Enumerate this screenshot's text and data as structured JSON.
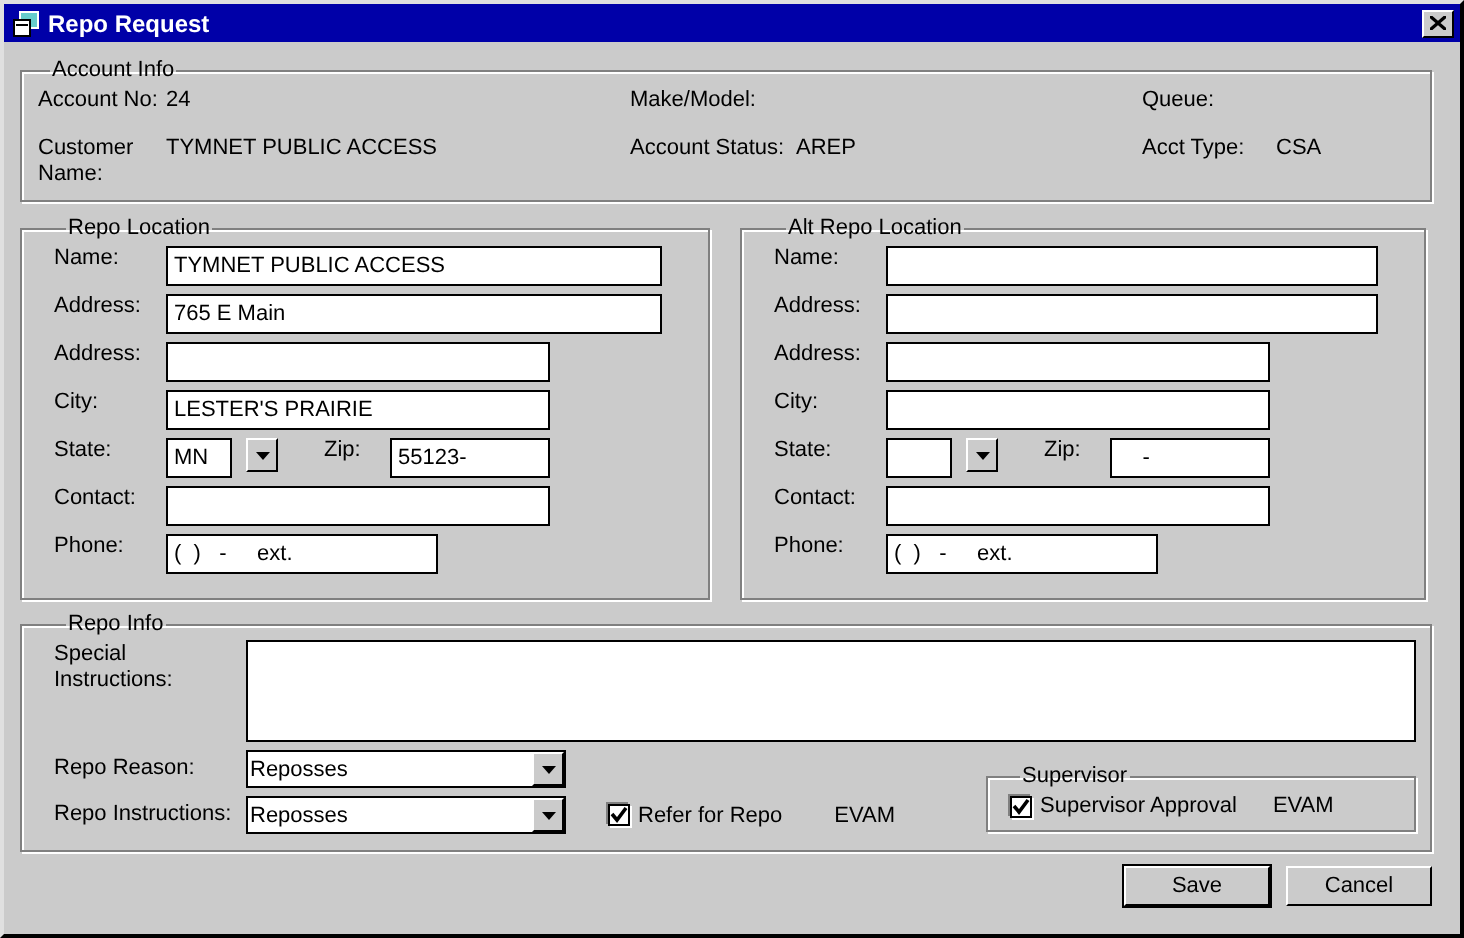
{
  "window": {
    "title": "Repo Request"
  },
  "account_info": {
    "title": "Account Info",
    "fields": [
      {
        "label": "Account No:",
        "value": "24"
      },
      {
        "label": "Make/Model:"
      },
      {
        "label": "Queue:"
      },
      {
        "label": "Customer Name:",
        "value": "TYMNET PUBLIC ACCESS"
      },
      {
        "label": "Account Status:",
        "value": "AREP"
      },
      {
        "label": "Acct Type:",
        "value": "CSA"
      }
    ]
  },
  "locations": [
    {
      "title": "Repo Location",
      "fields": [
        {
          "kind": "wide",
          "label": "Name:",
          "value": "TYMNET PUBLIC ACCESS"
        },
        {
          "kind": "wide",
          "label": "Address:",
          "value": "765 E Main"
        },
        {
          "kind": "medium",
          "label": "Address:"
        },
        {
          "kind": "medium",
          "label": "City:",
          "value": "LESTER'S PRAIRIE"
        },
        {
          "kind": "state",
          "label": "State:",
          "value": "MN",
          "zip_label": "Zip:",
          "zip_value": "55123-"
        },
        {
          "kind": "medium",
          "label": "Contact:"
        },
        {
          "kind": "short",
          "label": "Phone:",
          "value": "(  )   -     ext."
        }
      ]
    },
    {
      "title": "Alt Repo Location",
      "fields": [
        {
          "kind": "wide",
          "label": "Name:"
        },
        {
          "kind": "wide",
          "label": "Address:"
        },
        {
          "kind": "medium",
          "label": "Address:"
        },
        {
          "kind": "medium",
          "label": "City:"
        },
        {
          "kind": "state",
          "label": "State:",
          "zip_label": "Zip:",
          "zip_value": "    -"
        },
        {
          "kind": "medium",
          "label": "Contact:"
        },
        {
          "kind": "short",
          "label": "Phone:",
          "value": "(  )   -     ext."
        }
      ]
    }
  ],
  "repo_info": {
    "title": "Repo Info",
    "special_label": "Special Instructions:",
    "reason": {
      "label": "Repo Reason:",
      "value": "Reposses"
    },
    "instructions": {
      "label": "Repo Instructions:",
      "value": "Reposses"
    },
    "refer": {
      "label": "Refer for Repo",
      "checked": true,
      "user": "EVAM"
    },
    "supervisor": {
      "title": "Supervisor",
      "label": "Supervisor Approval",
      "checked": true,
      "user": "EVAM"
    }
  },
  "buttons": [
    {
      "label": "Save",
      "default": true
    },
    {
      "label": "Cancel",
      "default": false
    }
  ]
}
